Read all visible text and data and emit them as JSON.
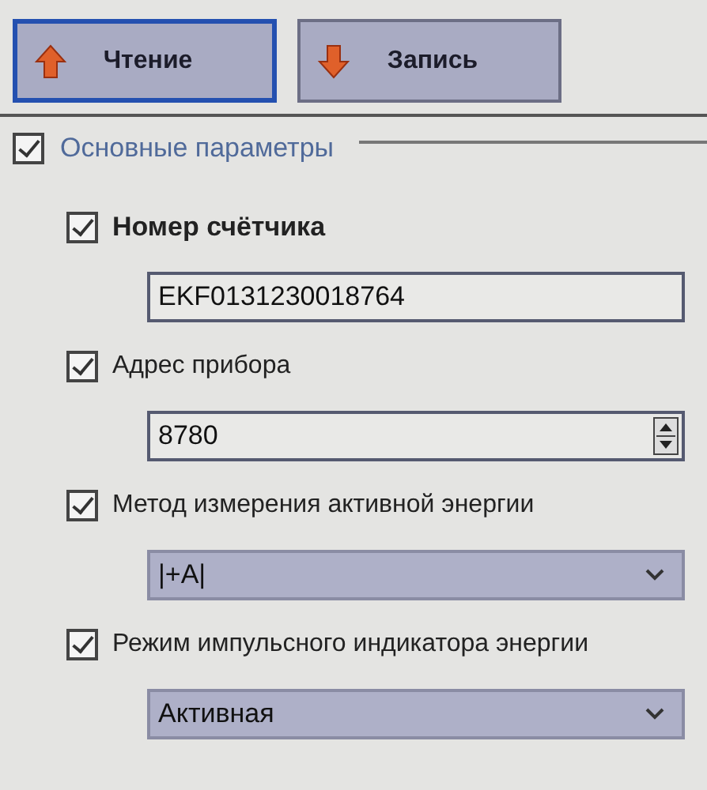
{
  "toolbar": [
    {
      "label": "Чтение",
      "kind": "up",
      "focused": true
    },
    {
      "label": "Запись",
      "kind": "down",
      "focused": false
    }
  ],
  "group": {
    "label": "Основные параметры",
    "checked": true,
    "items": [
      {
        "label": "Номер счётчика",
        "checked": true,
        "kind": "text",
        "value": "EKF0131230018764"
      },
      {
        "label": "Адрес прибора",
        "checked": true,
        "kind": "spin",
        "value": "8780"
      },
      {
        "label": "Метод измерения активной энергии",
        "checked": true,
        "kind": "select",
        "value": "|+A|"
      },
      {
        "label": "Режим импульсного индикатора энергии",
        "checked": true,
        "kind": "select",
        "value": "Активная"
      }
    ]
  }
}
